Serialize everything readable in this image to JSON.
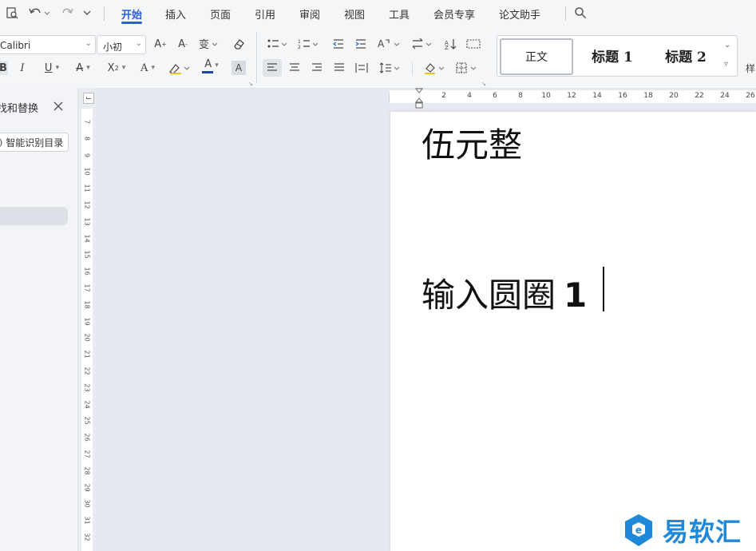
{
  "menu": {
    "tabs": [
      "开始",
      "插入",
      "页面",
      "引用",
      "审阅",
      "视图",
      "工具",
      "会员专享",
      "论文助手"
    ],
    "active_tab": "开始"
  },
  "ribbon": {
    "font_name": "Calibri",
    "font_size": "小初",
    "styles": [
      "正文",
      "标题 1",
      "标题 2"
    ],
    "style_more": "样"
  },
  "left_pane": {
    "title": "找和替换",
    "smart_toc_button": "智能识别目录"
  },
  "ruler": {
    "h_labels": [
      "2",
      "4",
      "6",
      "8",
      "10",
      "12",
      "14",
      "16",
      "18",
      "20",
      "22",
      "24",
      "26"
    ],
    "v_labels": [
      "7",
      "8",
      "9",
      "10",
      "11",
      "12",
      "13",
      "14",
      "15",
      "16",
      "17",
      "18",
      "19",
      "20",
      "21",
      "22",
      "23",
      "24",
      "25",
      "26",
      "27",
      "28",
      "29",
      "30",
      "31",
      "32"
    ]
  },
  "document": {
    "line1": "伍元整",
    "line2_text": "输入圆圈",
    "line2_num": "1"
  },
  "watermark": "易软汇",
  "colors": {
    "accent": "#2b5fd9",
    "font_color_bar": "#1f3fbf",
    "watermark": "#1f88d8"
  }
}
